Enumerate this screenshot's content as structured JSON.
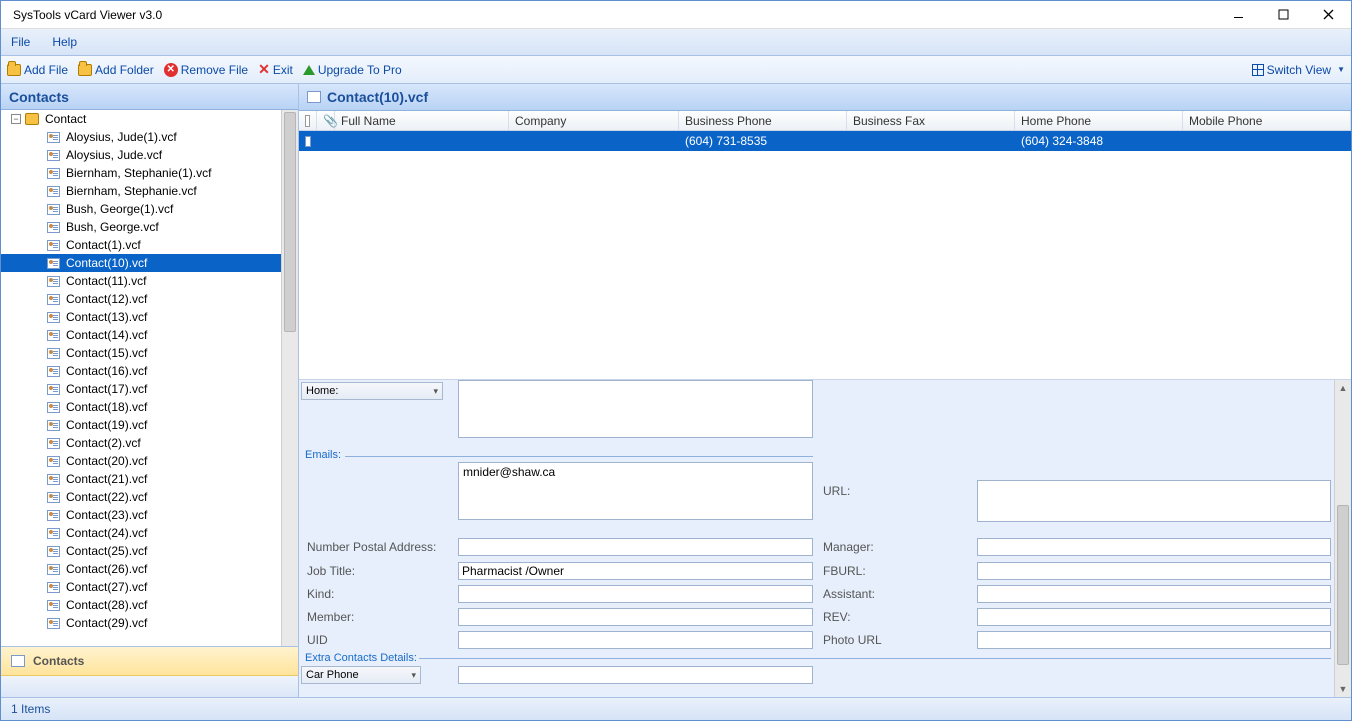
{
  "app": {
    "title": "SysTools vCard Viewer v3.0"
  },
  "menu": {
    "file": "File",
    "help": "Help"
  },
  "toolbar": {
    "add_file": "Add File",
    "add_folder": "Add Folder",
    "remove_file": "Remove File",
    "exit": "Exit",
    "upgrade": "Upgrade To Pro",
    "switch_view": "Switch View"
  },
  "sidebar": {
    "header": "Contacts",
    "root": "Contact",
    "items": [
      "Aloysius, Jude(1).vcf",
      "Aloysius, Jude.vcf",
      "Biernham, Stephanie(1).vcf",
      "Biernham, Stephanie.vcf",
      "Bush, George(1).vcf",
      "Bush, George.vcf",
      "Contact(1).vcf",
      "Contact(10).vcf",
      "Contact(11).vcf",
      "Contact(12).vcf",
      "Contact(13).vcf",
      "Contact(14).vcf",
      "Contact(15).vcf",
      "Contact(16).vcf",
      "Contact(17).vcf",
      "Contact(18).vcf",
      "Contact(19).vcf",
      "Contact(2).vcf",
      "Contact(20).vcf",
      "Contact(21).vcf",
      "Contact(22).vcf",
      "Contact(23).vcf",
      "Contact(24).vcf",
      "Contact(25).vcf",
      "Contact(26).vcf",
      "Contact(27).vcf",
      "Contact(28).vcf",
      "Contact(29).vcf"
    ],
    "selected_index": 7,
    "nav_label": "Contacts"
  },
  "main": {
    "file_header": "Contact(10).vcf",
    "columns": {
      "full_name": "Full Name",
      "company": "Company",
      "business_phone": "Business Phone",
      "business_fax": "Business Fax",
      "home_phone": "Home Phone",
      "mobile_phone": "Mobile Phone"
    },
    "row": {
      "full_name": "",
      "company": "",
      "business_phone": "(604) 731-8535",
      "business_fax": "",
      "home_phone": "(604) 324-3848",
      "mobile_phone": ""
    }
  },
  "details": {
    "addr_type": "Home:",
    "emails_label": "Emails:",
    "email_value": "mnider@shaw.ca",
    "url_label": "URL:",
    "num_postal_label": "Number Postal Address:",
    "manager_label": "Manager:",
    "job_title_label": "Job Title:",
    "job_title_value": "Pharmacist /Owner",
    "fburl_label": "FBURL:",
    "kind_label": "Kind:",
    "assistant_label": "Assistant:",
    "member_label": "Member:",
    "rev_label": "REV:",
    "uid_label": "UID",
    "photo_url_label": "Photo URL",
    "extra_label": "Extra Contacts Details:",
    "extra_select": "Car Phone"
  },
  "status": {
    "items": "1 Items"
  },
  "icons": {
    "attach": "📎"
  }
}
